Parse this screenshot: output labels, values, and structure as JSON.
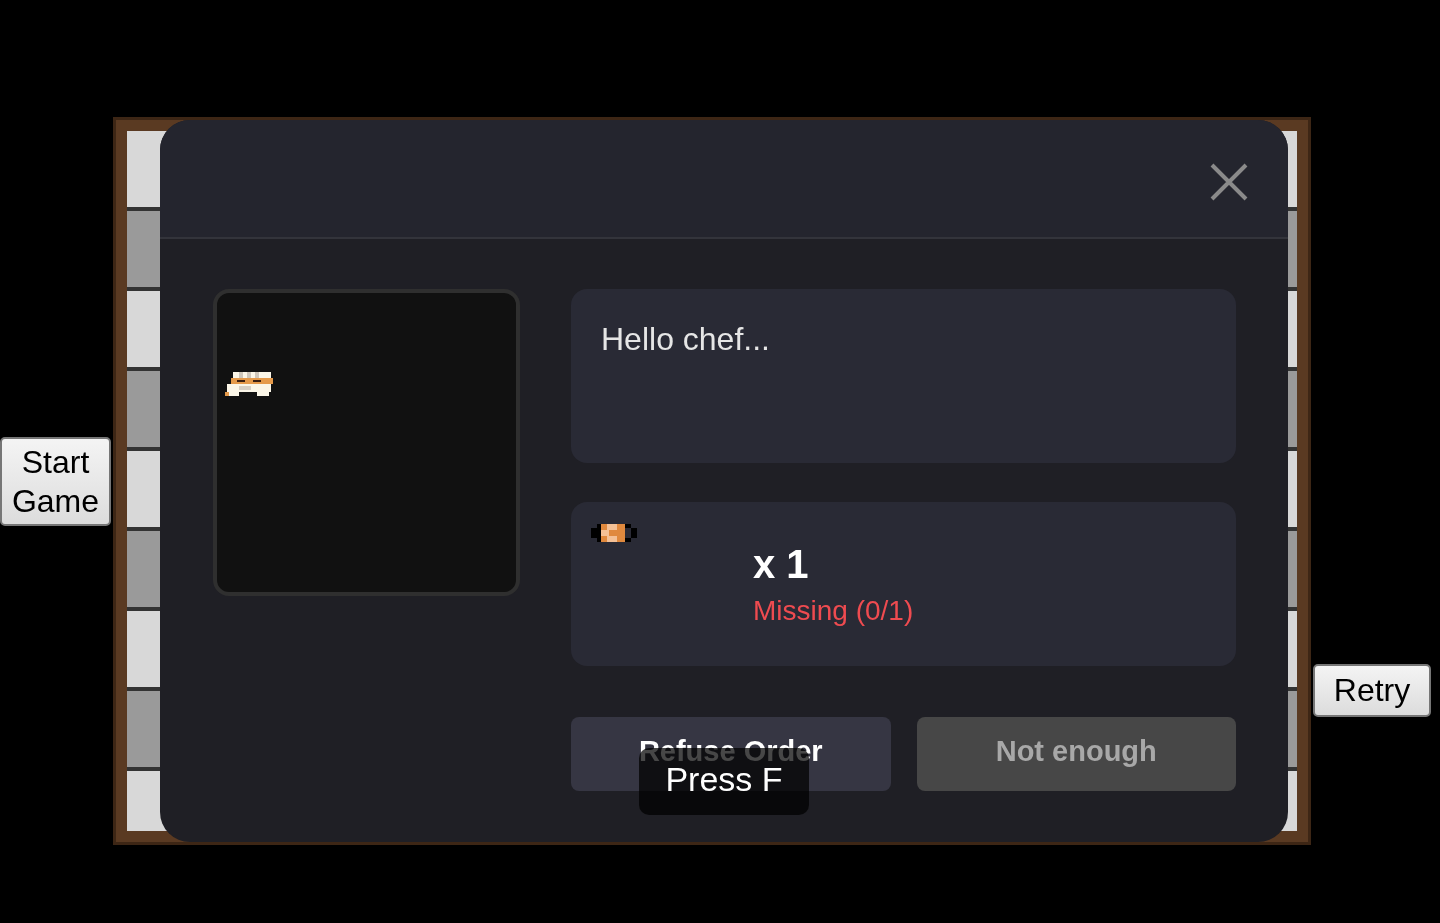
{
  "game": {
    "buttons": [
      {
        "label": "Start Game",
        "kind": "start"
      },
      {
        "label": "Retry",
        "kind": "retry"
      }
    ]
  },
  "dialog": {
    "message": "Hello chef...",
    "order": {
      "quantity": "x 1",
      "status": "Missing (0/1)",
      "satisfied": false
    },
    "buttons": [
      {
        "label": "Refuse Order",
        "disabled": false
      },
      {
        "label": "Not enough",
        "disabled": true
      }
    ]
  },
  "prompt": "Press F"
}
